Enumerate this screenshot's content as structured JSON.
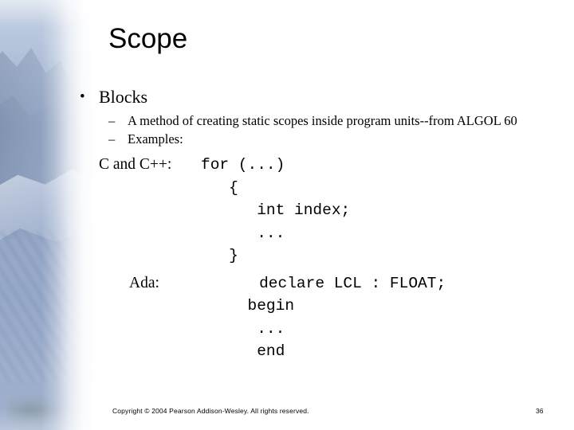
{
  "slide": {
    "title": "Scope",
    "bullets": [
      {
        "marker": "•",
        "text": "Blocks",
        "sub": [
          {
            "marker": "–",
            "text": "A method of creating static scopes inside program units--from ALGOL 60"
          },
          {
            "marker": "–",
            "text": "Examples:"
          }
        ]
      }
    ],
    "examples": [
      {
        "label": "C and C++:",
        "lines": [
          "for (...)",
          "   {",
          "      int index;",
          "      ...",
          "   }"
        ]
      },
      {
        "label": "Ada:",
        "lines": [
          "   declare LCL : FLOAT;",
          "     begin",
          "      ...",
          "      end"
        ]
      }
    ]
  },
  "footer": {
    "copyright": "Copyright © 2004 Pearson Addison-Wesley. All rights reserved.",
    "page_number": "36"
  },
  "colors": {
    "text": "#000000",
    "background": "#ffffff",
    "photo_blue": "#8fa2c5",
    "photo_sky": "#a9bcd8"
  }
}
